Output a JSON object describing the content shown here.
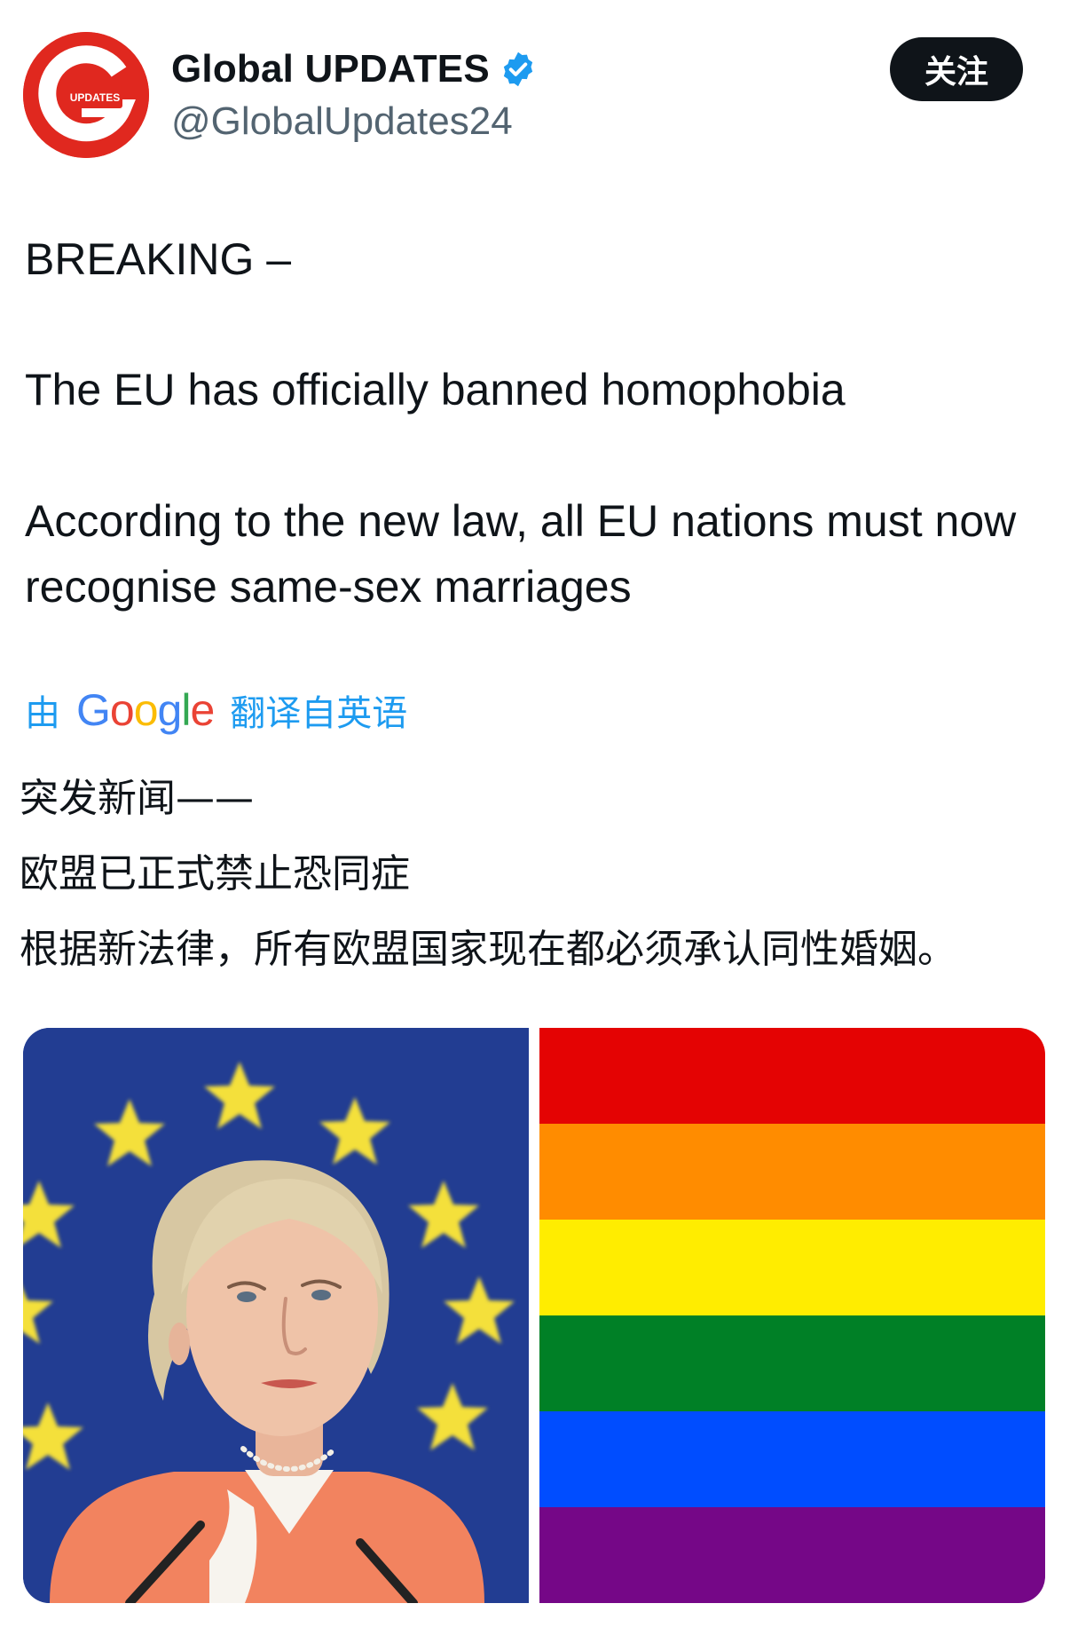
{
  "account": {
    "name": "Global UPDATES",
    "handle": "@GlobalUpdates24",
    "avatar_text": "UPDATES",
    "avatar_letter": "G",
    "avatar_color": "#e0281f",
    "verified_icon": "verified-badge-icon",
    "verified_color": "#1d9bf0"
  },
  "follow_button": {
    "label": "关注"
  },
  "tweet": {
    "line1": "BREAKING –",
    "line2": "The EU has officially banned homophobia",
    "line3": "According to the new law, all EU nations must now recognise same-sex marriages"
  },
  "translation": {
    "prefix": "由",
    "google": [
      "G",
      "o",
      "o",
      "g",
      "l",
      "e"
    ],
    "suffix": "翻译自英语",
    "line1": "突发新闻——",
    "line2": "欧盟已正式禁止恐同症",
    "line3": "根据新法律，所有欧盟国家现在都必须承认同性婚姻。"
  },
  "media": {
    "left_image": "eu-flag-portrait-photo",
    "right_image": "rainbow-flag",
    "rainbow_colors": [
      "#e40303",
      "#ff8c00",
      "#ffed00",
      "#008026",
      "#004dff",
      "#750787"
    ]
  },
  "colors": {
    "text": "#0f1419",
    "secondary": "#536471",
    "link": "#1d9bf0",
    "eu_blue": "#223d92",
    "eu_star": "#f4e03a"
  }
}
